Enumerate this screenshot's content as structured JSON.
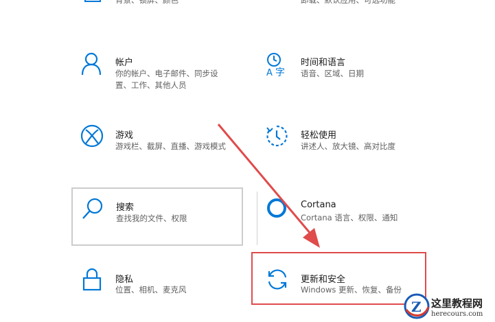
{
  "colors": {
    "accent": "#0078d7",
    "arrow": "#e04b4b",
    "highlight": "#e04b4b"
  },
  "partial_top": {
    "left_desc": "背景、锁屏、颜色",
    "right_desc": "卸载、默认应用、可选功能"
  },
  "tiles": {
    "accounts": {
      "title": "帐户",
      "desc1": "你的帐户、电子邮件、同步设",
      "desc2": "置、工作、其他人员",
      "icon": "person-icon"
    },
    "time_language": {
      "title": "时间和语言",
      "desc1": "语音、区域、日期",
      "icon": "time-language-icon"
    },
    "gaming": {
      "title": "游戏",
      "desc1": "游戏栏、截屏、直播、游戏模式",
      "icon": "xbox-icon"
    },
    "ease_of_access": {
      "title": "轻松使用",
      "desc1": "讲述人、放大镜、高对比度",
      "icon": "ease-of-access-icon"
    },
    "search": {
      "title": "搜索",
      "desc1": "查找我的文件、权限",
      "icon": "search-icon"
    },
    "cortana": {
      "title": "Cortana",
      "desc1": "Cortana 语言、权限、通知",
      "icon": "cortana-icon"
    },
    "privacy": {
      "title": "隐私",
      "desc1": "位置、相机、麦克风",
      "icon": "lock-icon"
    },
    "update_security": {
      "title": "更新和安全",
      "desc1": "Windows 更新、恢复、备份",
      "icon": "sync-icon"
    }
  },
  "watermark": {
    "title": "这里教程网",
    "url": "herecours.com",
    "letter": "Z"
  }
}
